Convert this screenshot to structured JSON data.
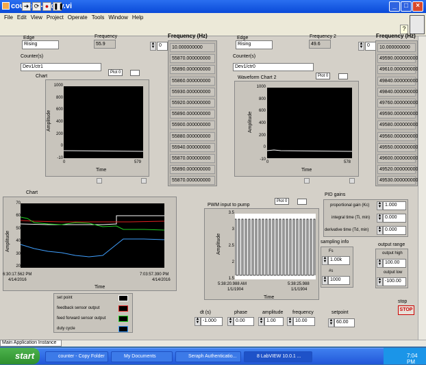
{
  "window": {
    "title": "counter - Copy.vi"
  },
  "menu": [
    "File",
    "Edit",
    "View",
    "Project",
    "Operate",
    "Tools",
    "Window",
    "Help"
  ],
  "counter1": {
    "edge_label": "Edge",
    "edge_value": "Rising",
    "freq_label": "Frequency",
    "freq_value": "55.9",
    "counter_label": "Counter(s)",
    "counter_value": "Dev1/ctr1",
    "index": "0",
    "array_title": "Frequency (Hz)",
    "values": [
      "10.000000000",
      "55870.000000000",
      "55890.000000000",
      "55860.000000000",
      "55930.000000000",
      "55920.000000000",
      "55890.000000000",
      "55900.000000000",
      "55880.000000000",
      "55940.000000000",
      "55870.000000000",
      "55890.000000000",
      "55870.000000000"
    ]
  },
  "chart1": {
    "title": "Chart",
    "plot_label": "Plot 0",
    "ylabel": "Amplitude",
    "xlabel": "Time",
    "yticks": [
      "1000",
      "800",
      "600",
      "400",
      "200",
      "0",
      "-10"
    ],
    "xmin": "0",
    "xmax": "579"
  },
  "counter2": {
    "edge_label": "Edge",
    "edge_value": "Rising",
    "freq_label": "Frequency 2",
    "freq_value": "49.6",
    "counter_label": "Counter(s)",
    "counter_value": "Dev1/ctr0",
    "index": "0",
    "array_title": "Frequency (Hz)",
    "values": [
      "10.000000000",
      "49590.000000000",
      "49610.000000000",
      "49840.000000000",
      "49840.000000000",
      "49760.000000000",
      "49590.000000000",
      "49580.000000000",
      "49560.000000000",
      "49550.000000000",
      "49600.000000000",
      "49520.000000000",
      "49530.000000000"
    ]
  },
  "chart2": {
    "title": "Waveform Chart 2",
    "plot_label": "Plot 0",
    "ylabel": "Amplitude",
    "xlabel": "Time",
    "yticks": [
      "1000",
      "800",
      "600",
      "400",
      "200",
      "0",
      "-10"
    ],
    "xmin": "0",
    "xmax": "578"
  },
  "chart3": {
    "title": "Chart",
    "ylabel": "Amplitude",
    "xlabel": "Time",
    "yticks": [
      "70",
      "60",
      "50",
      "40",
      "30",
      "20"
    ],
    "xstart_time": "6:30:17.562 PM",
    "xstart_date": "4/14/2016",
    "xend_time": "7:03:57.390 PM",
    "xend_date": "4/14/2016",
    "legend": [
      "set point",
      "feedback sensor output",
      "feed forward sensor output",
      "duty cycle"
    ]
  },
  "pwm": {
    "title": "PWM input to pump",
    "plot_label": "Plot 0",
    "ylabel": "Amplitude",
    "xlabel": "Time",
    "yticks": [
      "3.5",
      "3",
      "2.5",
      "2",
      "1.5"
    ],
    "xstart_time": "5:38:20.988 AM",
    "xstart_date": "1/1/1904",
    "xend_time": "5:38:25.988",
    "xend_date": "1/1/1904"
  },
  "pid": {
    "title": "PID gains",
    "kc_label": "proportional gain (Kc)",
    "kc_value": "1.000",
    "ti_label": "integral time (Ti, min)",
    "ti_value": "0.000",
    "td_label": "derivative time (Td, min)",
    "td_value": "0.000"
  },
  "sampling": {
    "title": "sampling info",
    "fs_label": "Fs",
    "fs_value": "1.00k",
    "ns_label": "#s",
    "ns_value": "1000"
  },
  "output_range": {
    "title": "output range",
    "high_label": "output high",
    "high_value": "100.00",
    "low_label": "output low",
    "low_value": "-100.00"
  },
  "controls": {
    "dt_label": "dt (s)",
    "dt_value": "-1.000",
    "phase_label": "phase",
    "phase_value": "0.00",
    "amp_label": "amplitude",
    "amp_value": "1.00",
    "freq_label": "frequency",
    "freq_value": "10.00",
    "setpoint_label": "setpoint",
    "setpoint_value": "60.00",
    "stop_label": "stop",
    "stop_button": "STOP"
  },
  "status": "Main Application Instance",
  "taskbar": {
    "start": "start",
    "items": [
      "counter - Copy Folder",
      "My Documents",
      "Seraph Authenticatio...",
      "8 LabVIEW 10.0.1 ..."
    ],
    "clock": "7:04 PM"
  },
  "colors": {
    "chart_bg": "#000000",
    "feedback": "#e02020",
    "feedforward": "#20d020",
    "duty": "#40a0ff",
    "setpoint": "#ffffff"
  }
}
